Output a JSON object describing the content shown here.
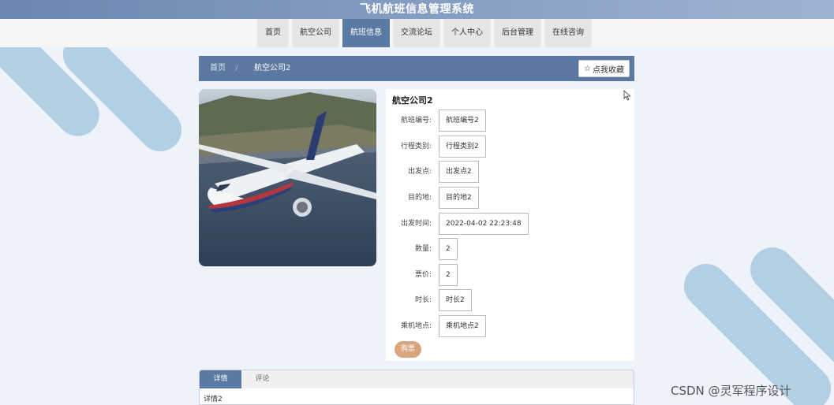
{
  "header": {
    "title": "飞机航班信息管理系统"
  },
  "nav": [
    {
      "label": "首页",
      "active": false
    },
    {
      "label": "航空公司",
      "active": false
    },
    {
      "label": "航班信息",
      "active": true
    },
    {
      "label": "交流论坛",
      "active": false
    },
    {
      "label": "个人中心",
      "active": false
    },
    {
      "label": "后台管理",
      "active": false
    },
    {
      "label": "在线咨询",
      "active": false
    }
  ],
  "breadcrumb": {
    "home": "首页",
    "separator": "/",
    "current": "航空公司2"
  },
  "favorite": {
    "icon": "star-outline-icon",
    "label": "点我收藏"
  },
  "detail": {
    "title": "航空公司2",
    "fields": [
      {
        "label": "航班编号:",
        "value": "航班编号2"
      },
      {
        "label": "行程类别:",
        "value": "行程类别2"
      },
      {
        "label": "出发点:",
        "value": "出发点2"
      },
      {
        "label": "目的地:",
        "value": "目的地2"
      },
      {
        "label": "出发时间:",
        "value": "2022-04-02 22:23:48"
      },
      {
        "label": "数量:",
        "value": "2"
      },
      {
        "label": "票价:",
        "value": "2"
      },
      {
        "label": "时长:",
        "value": "时长2"
      },
      {
        "label": "乘机地点:",
        "value": "乘机地点2"
      }
    ],
    "buy_label": "购票"
  },
  "tabs": {
    "items": [
      {
        "label": "详情",
        "active": true
      },
      {
        "label": "评论",
        "active": false
      }
    ],
    "content": "详情2"
  },
  "watermark": "CSDN @灵军程序设计",
  "colors": {
    "primary": "#5a7aa4",
    "buy": "#d9a57f",
    "background": "#eef2fa",
    "decoration": "#b3cfe3"
  }
}
